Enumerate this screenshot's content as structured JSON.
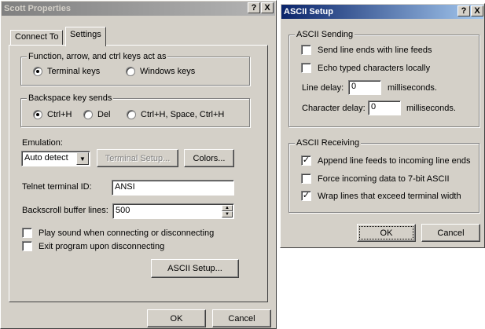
{
  "scott_properties": {
    "title": "Scott Properties",
    "help_btn": "?",
    "close_btn": "X",
    "tabs": [
      {
        "label": "Connect To"
      },
      {
        "label": "Settings"
      }
    ],
    "keys_group": {
      "title": "Function, arrow, and ctrl keys act as",
      "options": [
        "Terminal keys",
        "Windows keys"
      ]
    },
    "backspace_group": {
      "title": "Backspace key sends",
      "options": [
        "Ctrl+H",
        "Del",
        "Ctrl+H, Space, Ctrl+H"
      ]
    },
    "emulation_label": "Emulation:",
    "emulation_value": "Auto detect",
    "terminal_setup_btn": "Terminal Setup...",
    "colors_btn": "Colors...",
    "telnet_label": "Telnet terminal ID:",
    "telnet_value": "ANSI",
    "backscroll_label": "Backscroll buffer lines:",
    "backscroll_value": "500",
    "checks": [
      {
        "label": "Play sound when connecting or disconnecting"
      },
      {
        "label": "Exit program upon disconnecting"
      }
    ],
    "ascii_setup_btn": "ASCII Setup...",
    "ok_btn": "OK",
    "cancel_btn": "Cancel"
  },
  "ascii_setup": {
    "title": "ASCII Setup",
    "help_btn": "?",
    "close_btn": "X",
    "sending": {
      "title": "ASCII Sending",
      "checks": [
        {
          "label": "Send line ends with line feeds"
        },
        {
          "label": "Echo typed characters locally"
        }
      ],
      "line_delay_label": "Line delay:",
      "line_delay_value": "0",
      "line_delay_unit": "milliseconds.",
      "char_delay_label": "Character delay:",
      "char_delay_value": "0",
      "char_delay_unit": "milliseconds."
    },
    "receiving": {
      "title": "ASCII Receiving",
      "checks": [
        {
          "label": "Append line feeds to incoming line ends"
        },
        {
          "label": "Force incoming data to 7-bit ASCII"
        },
        {
          "label": "Wrap lines that exceed terminal width"
        }
      ]
    },
    "ok_btn": "OK",
    "cancel_btn": "Cancel"
  }
}
